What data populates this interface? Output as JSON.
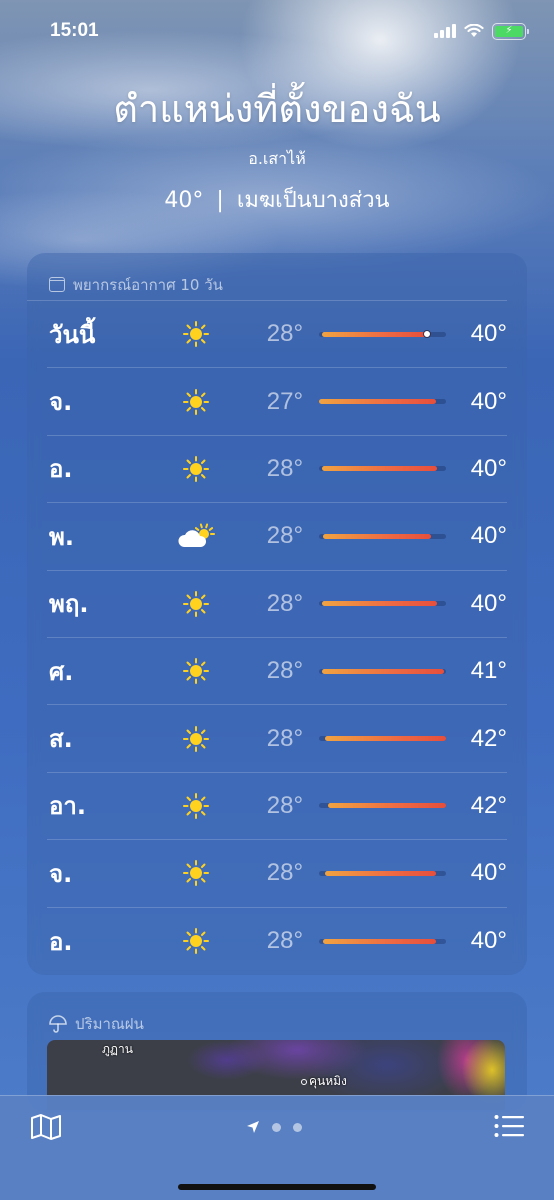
{
  "status_bar": {
    "time": "15:01"
  },
  "header": {
    "location": "ตำแหน่งที่ตั้งของฉัน",
    "sublocation": "อ.เสาไห้",
    "temperature": "40°",
    "separator": "|",
    "condition": "เมฆเป็นบางส่วน"
  },
  "forecast": {
    "title": "พยากรณ์อากาศ 10 วัน",
    "days": [
      {
        "day": "วันนี้",
        "icon": "sun-icon",
        "low": "28°",
        "high": "40°",
        "bar_start": 0.02,
        "bar_end": 0.85,
        "current": 0.85
      },
      {
        "day": "จ.",
        "icon": "sun-icon",
        "low": "27°",
        "high": "40°",
        "bar_start": 0.0,
        "bar_end": 0.92
      },
      {
        "day": "อ.",
        "icon": "sun-icon",
        "low": "28°",
        "high": "40°",
        "bar_start": 0.02,
        "bar_end": 0.93
      },
      {
        "day": "พ.",
        "icon": "partly-cloudy-icon",
        "low": "28°",
        "high": "40°",
        "bar_start": 0.03,
        "bar_end": 0.88
      },
      {
        "day": "พฤ.",
        "icon": "sun-icon",
        "low": "28°",
        "high": "40°",
        "bar_start": 0.02,
        "bar_end": 0.93
      },
      {
        "day": "ศ.",
        "icon": "sun-icon",
        "low": "28°",
        "high": "41°",
        "bar_start": 0.02,
        "bar_end": 0.98
      },
      {
        "day": "ส.",
        "icon": "sun-icon",
        "low": "28°",
        "high": "42°",
        "bar_start": 0.05,
        "bar_end": 1.0
      },
      {
        "day": "อา.",
        "icon": "sun-icon",
        "low": "28°",
        "high": "42°",
        "bar_start": 0.07,
        "bar_end": 1.0
      },
      {
        "day": "จ.",
        "icon": "sun-icon",
        "low": "28°",
        "high": "40°",
        "bar_start": 0.05,
        "bar_end": 0.92
      },
      {
        "day": "อ.",
        "icon": "sun-icon",
        "low": "28°",
        "high": "40°",
        "bar_start": 0.03,
        "bar_end": 0.92
      }
    ]
  },
  "rain": {
    "title": "ปริมาณฝน",
    "map_labels": [
      "ภูฏาน",
      "คุนหมิง"
    ]
  },
  "bottom_bar": {
    "icons": [
      "map-icon",
      "location-arrow-icon",
      "list-icon"
    ]
  },
  "colors": {
    "bar_gradient": [
      "#f0a341",
      "#e64f3c"
    ],
    "sun": "#ffd21f"
  }
}
